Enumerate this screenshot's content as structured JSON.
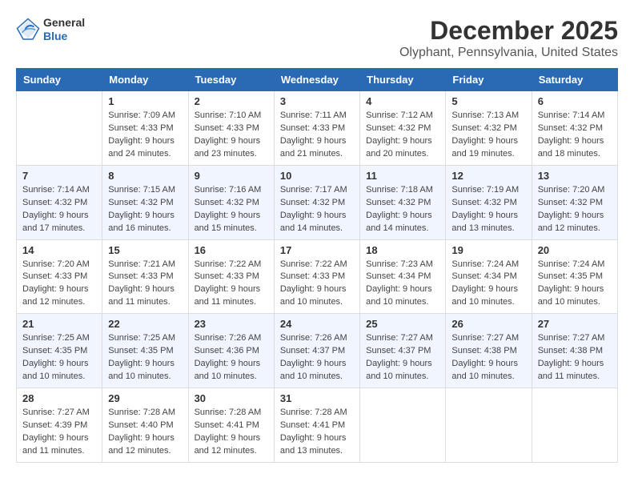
{
  "header": {
    "logo_general": "General",
    "logo_blue": "Blue",
    "month_title": "December 2025",
    "location": "Olyphant, Pennsylvania, United States"
  },
  "weekdays": [
    "Sunday",
    "Monday",
    "Tuesday",
    "Wednesday",
    "Thursday",
    "Friday",
    "Saturday"
  ],
  "weeks": [
    [
      {
        "day": "",
        "info": ""
      },
      {
        "day": "1",
        "info": "Sunrise: 7:09 AM\nSunset: 4:33 PM\nDaylight: 9 hours\nand 24 minutes."
      },
      {
        "day": "2",
        "info": "Sunrise: 7:10 AM\nSunset: 4:33 PM\nDaylight: 9 hours\nand 23 minutes."
      },
      {
        "day": "3",
        "info": "Sunrise: 7:11 AM\nSunset: 4:33 PM\nDaylight: 9 hours\nand 21 minutes."
      },
      {
        "day": "4",
        "info": "Sunrise: 7:12 AM\nSunset: 4:32 PM\nDaylight: 9 hours\nand 20 minutes."
      },
      {
        "day": "5",
        "info": "Sunrise: 7:13 AM\nSunset: 4:32 PM\nDaylight: 9 hours\nand 19 minutes."
      },
      {
        "day": "6",
        "info": "Sunrise: 7:14 AM\nSunset: 4:32 PM\nDaylight: 9 hours\nand 18 minutes."
      }
    ],
    [
      {
        "day": "7",
        "info": "Sunrise: 7:14 AM\nSunset: 4:32 PM\nDaylight: 9 hours\nand 17 minutes."
      },
      {
        "day": "8",
        "info": "Sunrise: 7:15 AM\nSunset: 4:32 PM\nDaylight: 9 hours\nand 16 minutes."
      },
      {
        "day": "9",
        "info": "Sunrise: 7:16 AM\nSunset: 4:32 PM\nDaylight: 9 hours\nand 15 minutes."
      },
      {
        "day": "10",
        "info": "Sunrise: 7:17 AM\nSunset: 4:32 PM\nDaylight: 9 hours\nand 14 minutes."
      },
      {
        "day": "11",
        "info": "Sunrise: 7:18 AM\nSunset: 4:32 PM\nDaylight: 9 hours\nand 14 minutes."
      },
      {
        "day": "12",
        "info": "Sunrise: 7:19 AM\nSunset: 4:32 PM\nDaylight: 9 hours\nand 13 minutes."
      },
      {
        "day": "13",
        "info": "Sunrise: 7:20 AM\nSunset: 4:32 PM\nDaylight: 9 hours\nand 12 minutes."
      }
    ],
    [
      {
        "day": "14",
        "info": "Sunrise: 7:20 AM\nSunset: 4:33 PM\nDaylight: 9 hours\nand 12 minutes."
      },
      {
        "day": "15",
        "info": "Sunrise: 7:21 AM\nSunset: 4:33 PM\nDaylight: 9 hours\nand 11 minutes."
      },
      {
        "day": "16",
        "info": "Sunrise: 7:22 AM\nSunset: 4:33 PM\nDaylight: 9 hours\nand 11 minutes."
      },
      {
        "day": "17",
        "info": "Sunrise: 7:22 AM\nSunset: 4:33 PM\nDaylight: 9 hours\nand 10 minutes."
      },
      {
        "day": "18",
        "info": "Sunrise: 7:23 AM\nSunset: 4:34 PM\nDaylight: 9 hours\nand 10 minutes."
      },
      {
        "day": "19",
        "info": "Sunrise: 7:24 AM\nSunset: 4:34 PM\nDaylight: 9 hours\nand 10 minutes."
      },
      {
        "day": "20",
        "info": "Sunrise: 7:24 AM\nSunset: 4:35 PM\nDaylight: 9 hours\nand 10 minutes."
      }
    ],
    [
      {
        "day": "21",
        "info": "Sunrise: 7:25 AM\nSunset: 4:35 PM\nDaylight: 9 hours\nand 10 minutes."
      },
      {
        "day": "22",
        "info": "Sunrise: 7:25 AM\nSunset: 4:35 PM\nDaylight: 9 hours\nand 10 minutes."
      },
      {
        "day": "23",
        "info": "Sunrise: 7:26 AM\nSunset: 4:36 PM\nDaylight: 9 hours\nand 10 minutes."
      },
      {
        "day": "24",
        "info": "Sunrise: 7:26 AM\nSunset: 4:37 PM\nDaylight: 9 hours\nand 10 minutes."
      },
      {
        "day": "25",
        "info": "Sunrise: 7:27 AM\nSunset: 4:37 PM\nDaylight: 9 hours\nand 10 minutes."
      },
      {
        "day": "26",
        "info": "Sunrise: 7:27 AM\nSunset: 4:38 PM\nDaylight: 9 hours\nand 10 minutes."
      },
      {
        "day": "27",
        "info": "Sunrise: 7:27 AM\nSunset: 4:38 PM\nDaylight: 9 hours\nand 11 minutes."
      }
    ],
    [
      {
        "day": "28",
        "info": "Sunrise: 7:27 AM\nSunset: 4:39 PM\nDaylight: 9 hours\nand 11 minutes."
      },
      {
        "day": "29",
        "info": "Sunrise: 7:28 AM\nSunset: 4:40 PM\nDaylight: 9 hours\nand 12 minutes."
      },
      {
        "day": "30",
        "info": "Sunrise: 7:28 AM\nSunset: 4:41 PM\nDaylight: 9 hours\nand 12 minutes."
      },
      {
        "day": "31",
        "info": "Sunrise: 7:28 AM\nSunset: 4:41 PM\nDaylight: 9 hours\nand 13 minutes."
      },
      {
        "day": "",
        "info": ""
      },
      {
        "day": "",
        "info": ""
      },
      {
        "day": "",
        "info": ""
      }
    ]
  ]
}
